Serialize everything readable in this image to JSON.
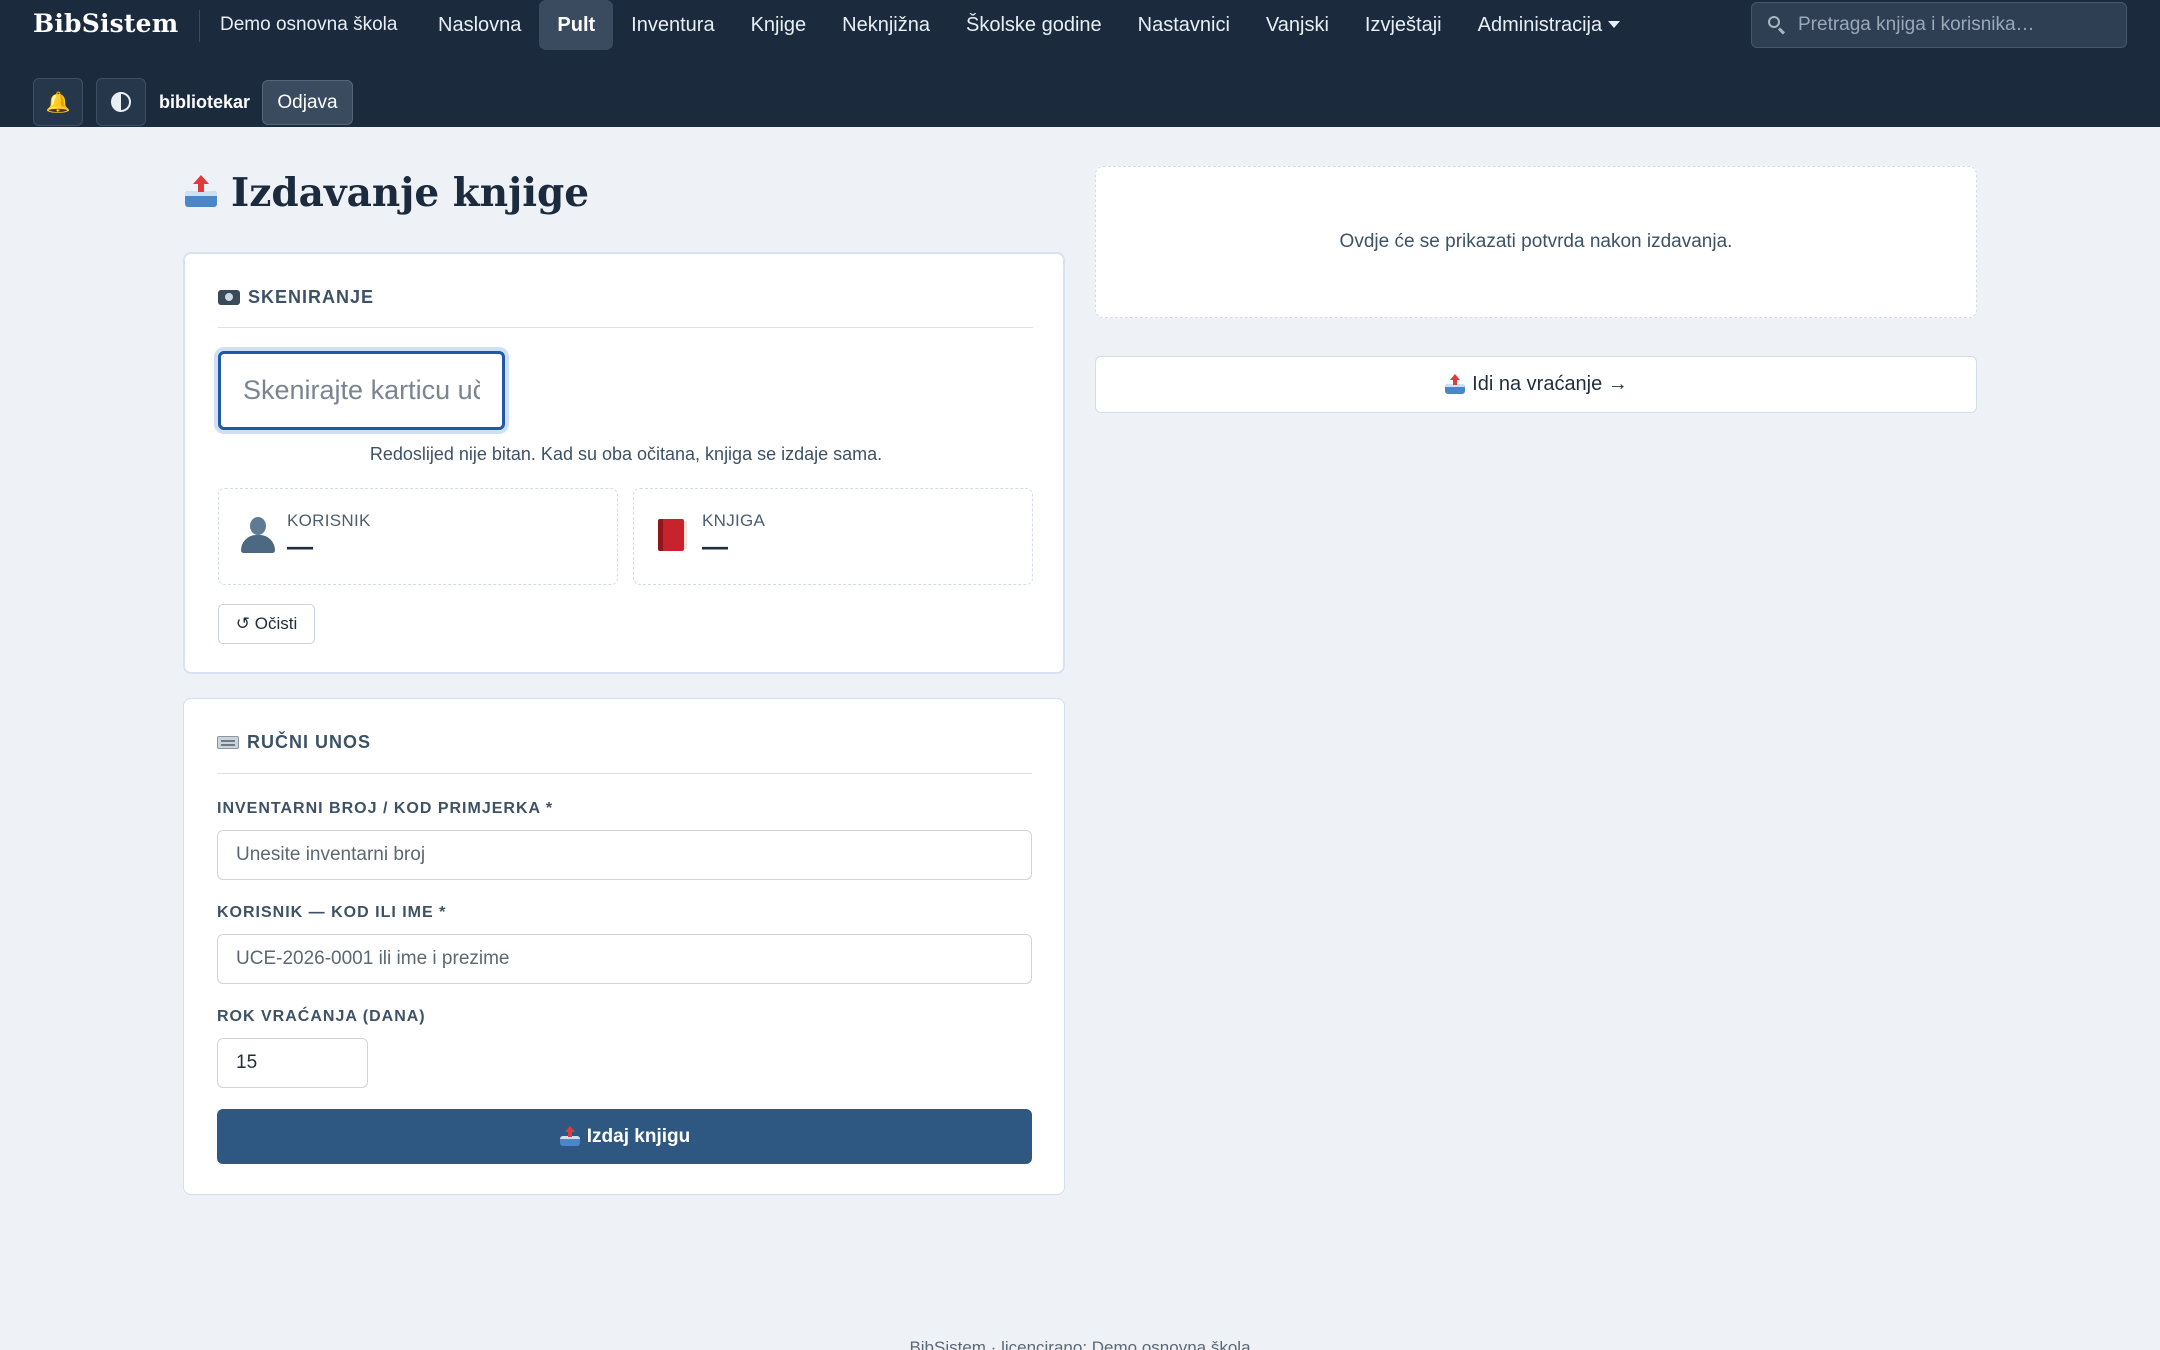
{
  "header": {
    "brand": "BibSistem",
    "school": "Demo osnovna škola",
    "nav": [
      {
        "label": "Naslovna",
        "active": false
      },
      {
        "label": "Pult",
        "active": true
      },
      {
        "label": "Inventura",
        "active": false
      },
      {
        "label": "Knjige",
        "active": false
      },
      {
        "label": "Neknjižna",
        "active": false
      },
      {
        "label": "Školske godine",
        "active": false
      },
      {
        "label": "Nastavnici",
        "active": false
      },
      {
        "label": "Vanjski",
        "active": false
      },
      {
        "label": "Izvještaji",
        "active": false
      },
      {
        "label": "Administracija",
        "active": false,
        "dropdown": true
      }
    ],
    "search_placeholder": "Pretraga knjiga i korisnika…",
    "notifications_icon": "bell-icon",
    "theme_icon": "contrast-icon",
    "user": "bibliotekar",
    "logout_label": "Odjava"
  },
  "page": {
    "title": "Izdavanje knjige"
  },
  "scan": {
    "title": "SKENIRANJE",
    "input_placeholder": "Skenirajte karticu učer",
    "hint": "Redoslijed nije bitan. Kad su oba očitana, knjiga se izdaje sama.",
    "user_label": "KORISNIK",
    "user_value": "—",
    "book_label": "KNJIGA",
    "book_value": "—",
    "clear_label": "↺ Očisti"
  },
  "manual": {
    "title": "RUČNI UNOS",
    "inventory_label": "INVENTARNI BROJ / KOD PRIMJERKA *",
    "inventory_placeholder": "Unesite inventarni broj",
    "user_label": "KORISNIK — KOD ILI IME *",
    "user_placeholder": "UCE-2026-0001 ili ime i prezime",
    "days_label": "ROK VRAĆANJA (DANA)",
    "days_value": "15",
    "submit_label": "Izdaj knjigu"
  },
  "side": {
    "confirm_text": "Ovdje će se prikazati potvrda nakon izdavanja.",
    "return_label": "Idi na vraćanje →"
  },
  "footer": {
    "text": "BibSistem · licencirano: Demo osnovna škola"
  },
  "colors": {
    "topbar": "#1b2a3c",
    "accent": "#2e5882",
    "focus": "#1e5aa8",
    "background": "#eef2f7"
  }
}
